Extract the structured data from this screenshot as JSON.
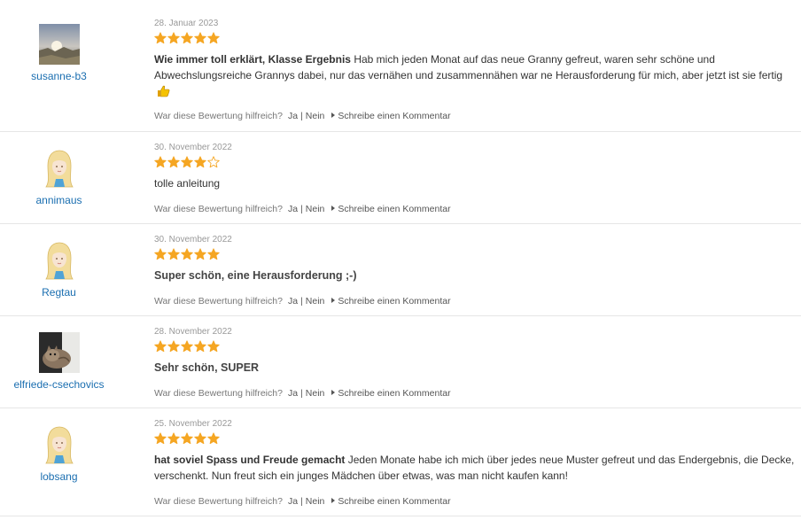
{
  "colors": {
    "star": "#f5a623",
    "link": "#1a6eb0",
    "divider": "#e6e6e6"
  },
  "helpful": {
    "question": "War diese Bewertung hilfreich?",
    "yes": "Ja",
    "separator": "|",
    "no": "Nein",
    "comment": "Schreibe einen Kommentar"
  },
  "reviews": [
    {
      "username": "susanne-b3",
      "avatar": "landscape-photo-avatar",
      "date": "28. Januar 2023",
      "rating": 5,
      "title": "Wie immer toll erklärt, Klasse Ergebnis",
      "body": " Hab mich jeden Monat auf das neue Granny gefreut, waren sehr schöne und Abwechslungsreiche Grannys dabei, nur das vernähen und zusammennähen war ne Herausforderung für mich, aber jetzt ist sie fertig",
      "emoji": "thumbs-up-icon"
    },
    {
      "username": "annimaus",
      "avatar": "default-blonde-avatar",
      "date": "30. November 2022",
      "rating": 4,
      "title": "",
      "body": "tolle anleitung"
    },
    {
      "username": "Regtau",
      "avatar": "default-blonde-avatar",
      "date": "30. November 2022",
      "rating": 5,
      "title": "Super schön, eine Herausforderung ;-)",
      "body": ""
    },
    {
      "username": "elfriede-csechovics",
      "avatar": "cat-photo-avatar",
      "date": "28. November 2022",
      "rating": 5,
      "title": "Sehr schön, SUPER",
      "body": ""
    },
    {
      "username": "lobsang",
      "avatar": "default-blonde-avatar",
      "date": "25. November 2022",
      "rating": 5,
      "title": "hat soviel Spass und Freude gemacht",
      "body": " Jeden Monate habe ich mich über jedes neue Muster gefreut und das Endergebnis, die Decke, verschenkt. Nun freut sich ein junges Mädchen über etwas, was man nicht kaufen kann!"
    }
  ]
}
